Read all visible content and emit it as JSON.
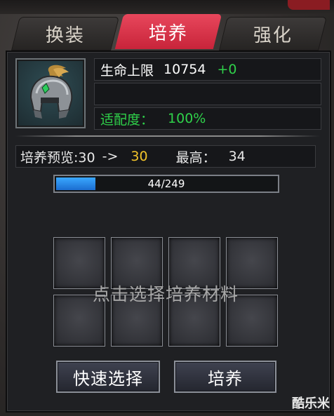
{
  "tabs": [
    {
      "label": "换装",
      "active": false
    },
    {
      "label": "培养",
      "active": true
    },
    {
      "label": "强化",
      "active": false
    }
  ],
  "item": {
    "icon": "helmet-icon"
  },
  "stats": {
    "hp_label": "生命上限",
    "hp_value": "10754",
    "hp_bonus": "+0",
    "fit_label": "适配度：",
    "fit_value": "100%"
  },
  "preview": {
    "label": "培养预览:30",
    "arrow": "->",
    "new_value": "30",
    "max_label": "最高：",
    "max_value": "34"
  },
  "progress": {
    "text": "44/249",
    "fraction": 0.177
  },
  "slots_hint": "点击选择培养材料",
  "buttons": {
    "quick_select": "快速选择",
    "cultivate": "培养"
  },
  "watermark": "酷乐米",
  "colors": {
    "active_tab": "#d8344c",
    "green": "#2fd14a",
    "yellow": "#f2c42a",
    "progress": "#2a8cf0"
  }
}
